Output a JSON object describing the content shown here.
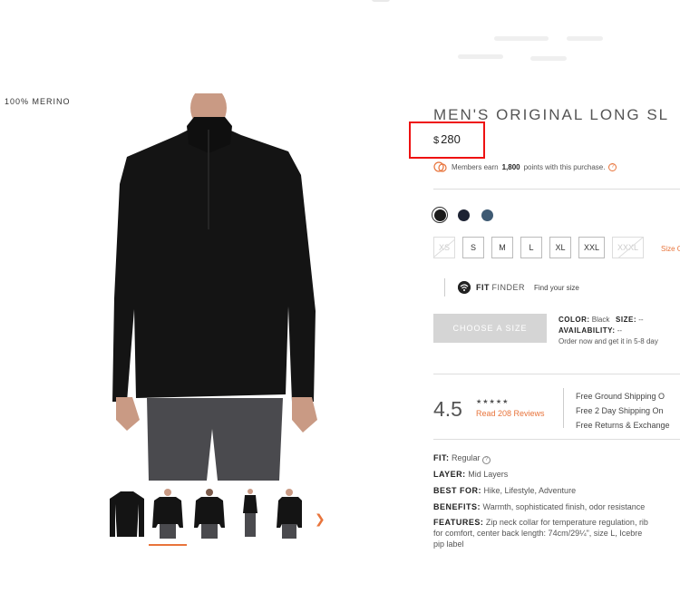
{
  "badge": "100% MERINO",
  "product": {
    "title": "MEN'S ORIGINAL LONG SL",
    "currency": "$",
    "price": "280",
    "members_prefix": "Members earn",
    "members_points": "1,800",
    "members_suffix": "points with this purchase.",
    "help_glyph": "?"
  },
  "colors": [
    {
      "name": "Black",
      "hex": "#1a1a1a",
      "selected": true
    },
    {
      "name": "Navy",
      "hex": "#1c2233",
      "selected": false
    },
    {
      "name": "Slate Blue",
      "hex": "#3e5a73",
      "selected": false
    }
  ],
  "sizes": [
    {
      "label": "XS",
      "available": false
    },
    {
      "label": "S",
      "available": true
    },
    {
      "label": "M",
      "available": true
    },
    {
      "label": "L",
      "available": true
    },
    {
      "label": "XL",
      "available": true
    },
    {
      "label": "XXL",
      "available": true
    },
    {
      "label": "XXXL",
      "available": false
    }
  ],
  "size_guide_label": "Size G",
  "fit_finder": {
    "brand_bold": "FIT",
    "brand_light": "FINDER",
    "subtitle": "Find your size"
  },
  "cta": {
    "choose_size": "CHOOSE A SIZE"
  },
  "availability": {
    "color_label": "COLOR:",
    "color_value": "Black",
    "size_label": "SIZE:",
    "size_value": "--",
    "avail_label": "AVAILABILITY:",
    "avail_value": "--",
    "order_text": "Order now and get it in 5-8 day"
  },
  "rating": {
    "value": "4.5",
    "stars": "★★★★★",
    "reviews_text": "Read 208 Reviews"
  },
  "perks": [
    "Free Ground Shipping O",
    "Free 2 Day Shipping On",
    "Free Returns & Exchange"
  ],
  "specs": {
    "fit_label": "FIT:",
    "fit_value": "Regular",
    "layer_label": "LAYER:",
    "layer_value": "Mid Layers",
    "best_label": "BEST FOR:",
    "best_value": "Hike, Lifestyle, Adventure",
    "benefits_label": "BENEFITS:",
    "benefits_value": "Warmth, sophisticated finish, odor resistance",
    "features_label": "FEATURES:",
    "features_line1": "Zip neck collar for temperature regulation, rib",
    "features_line2": "for comfort, center back length: 74cm/29¼\", size L, Icebre",
    "features_line3": "pip label"
  },
  "accent_color": "#e8743b",
  "highlight_color": "#e11111"
}
